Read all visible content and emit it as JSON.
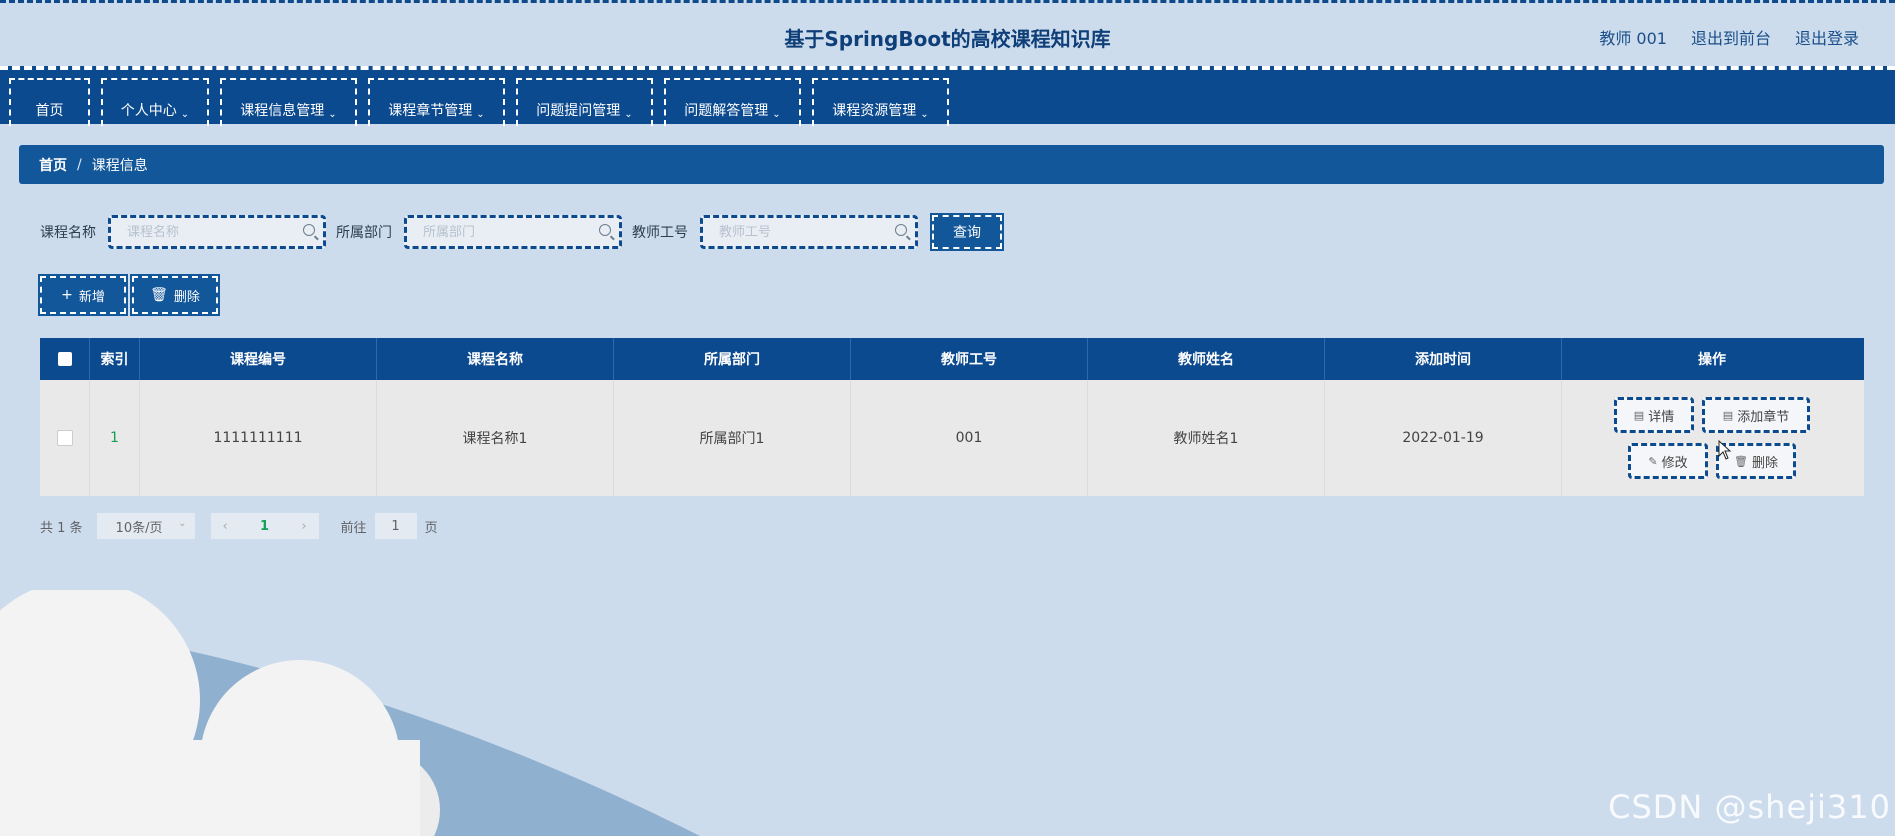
{
  "header": {
    "title": "基于SpringBoot的高校课程知识库",
    "user": "教师 001",
    "back_to_front": "退出到前台",
    "logout": "退出登录"
  },
  "nav": {
    "items": [
      {
        "label": "首页"
      },
      {
        "label": "个人中心",
        "has_dropdown": true
      },
      {
        "label": "课程信息管理",
        "has_dropdown": true
      },
      {
        "label": "课程章节管理",
        "has_dropdown": true
      },
      {
        "label": "问题提问管理",
        "has_dropdown": true
      },
      {
        "label": "问题解答管理",
        "has_dropdown": true
      },
      {
        "label": "课程资源管理",
        "has_dropdown": true
      }
    ]
  },
  "breadcrumb": {
    "home": "首页",
    "separator": "/",
    "current": "课程信息"
  },
  "search": {
    "course_name_label": "课程名称",
    "course_name_placeholder": "课程名称",
    "dept_label": "所属部门",
    "dept_placeholder": "所属部门",
    "teacher_id_label": "教师工号",
    "teacher_id_placeholder": "教师工号",
    "query_button": "查询"
  },
  "actions": {
    "add": "新增",
    "delete": "删除"
  },
  "table": {
    "columns": [
      "索引",
      "课程编号",
      "课程名称",
      "所属部门",
      "教师工号",
      "教师姓名",
      "添加时间",
      "操作"
    ],
    "rows": [
      {
        "index": "1",
        "course_no": "1111111111",
        "course_name": "课程名称1",
        "dept": "所属部门1",
        "teacher_id": "001",
        "teacher_name": "教师姓名1",
        "added": "2022-01-19",
        "ops": {
          "detail": "详情",
          "add_chapter": "添加章节",
          "edit": "修改",
          "delete": "删除"
        }
      }
    ]
  },
  "pager": {
    "total": "共 1 条",
    "page_size": "10条/页",
    "current_page": "1",
    "goto_label": "前往",
    "goto_value": "1",
    "page_suffix": "页"
  },
  "watermark": "CSDN @sheji310",
  "colors": {
    "primary": "#0c4a8f",
    "header_bg": "#cddced",
    "accent_green": "#13a054"
  }
}
